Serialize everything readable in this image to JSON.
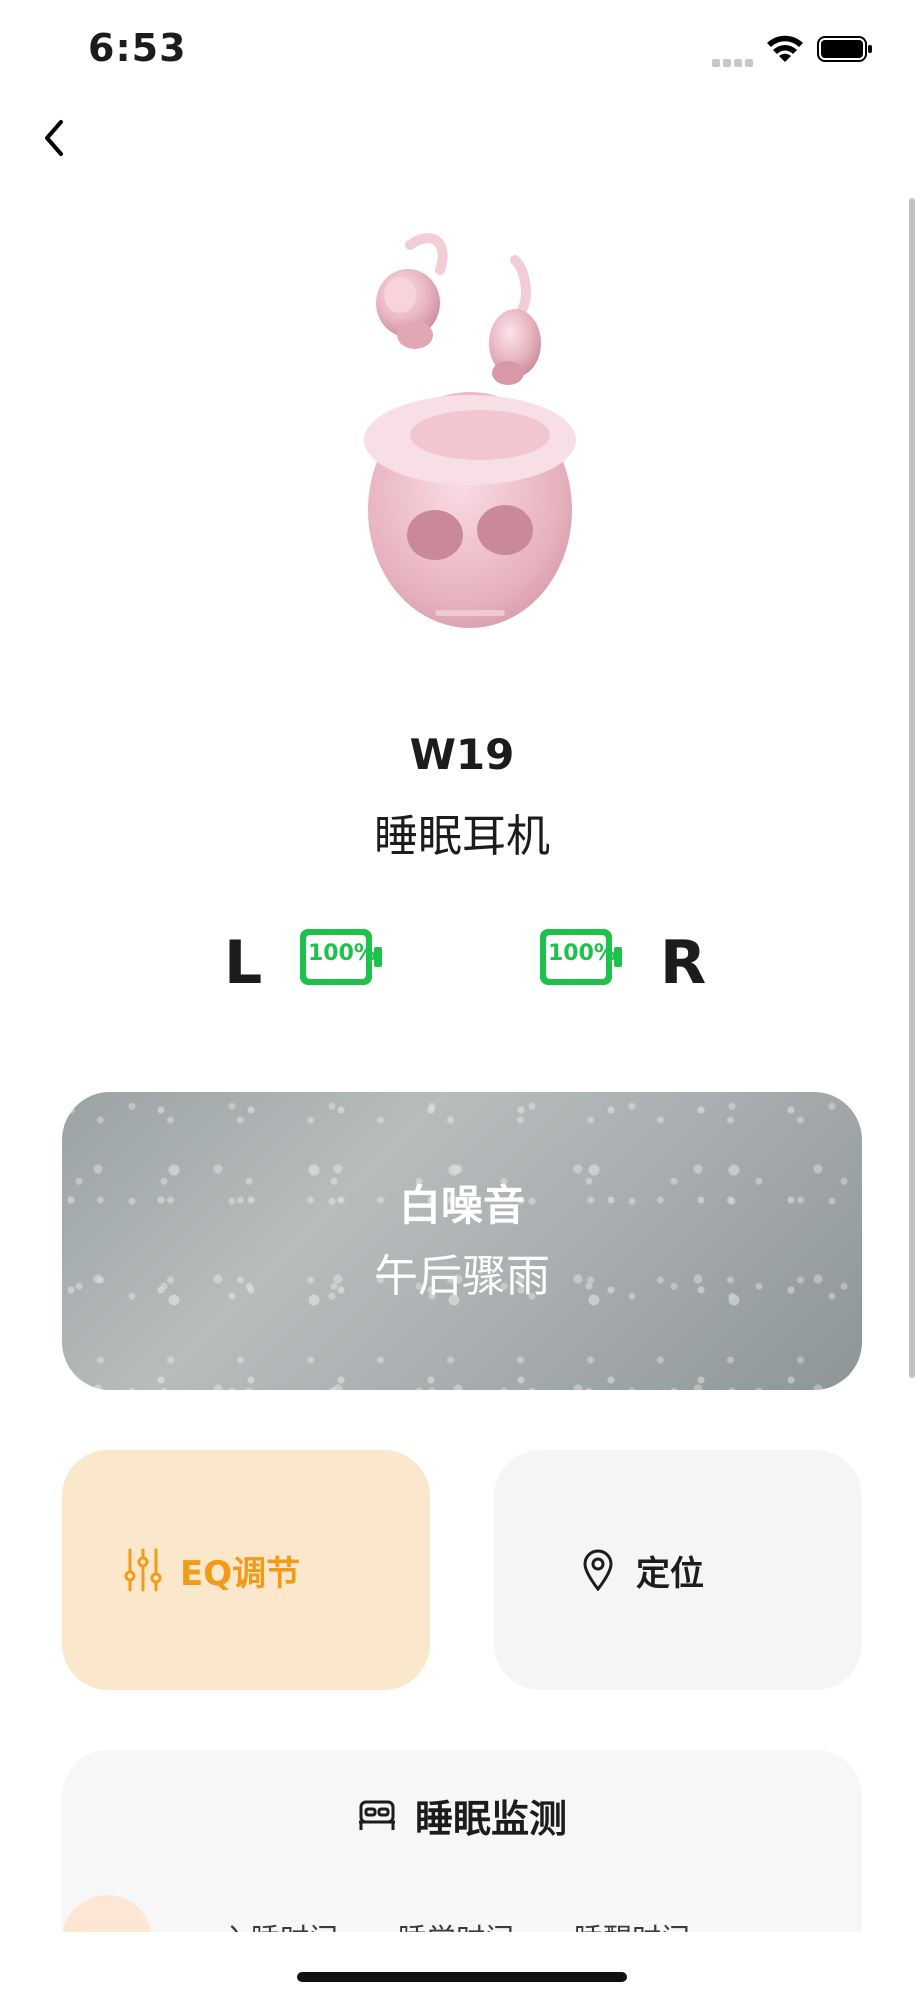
{
  "status_bar": {
    "time": "6:53"
  },
  "product": {
    "model": "W19",
    "name": "睡眠耳机"
  },
  "earbuds": {
    "left": {
      "label": "L",
      "battery_text": "100%",
      "battery_level": 1.0
    },
    "right": {
      "label": "R",
      "battery_text": "100%",
      "battery_level": 1.0
    }
  },
  "white_noise": {
    "title": "白噪音",
    "track": "午后骤雨"
  },
  "actions": {
    "eq_label": "EQ调节",
    "locate_label": "定位"
  },
  "sleep_monitor": {
    "title": "睡眠监测",
    "columns": [
      "入睡时间",
      "睡觉时间",
      "睡醒时间"
    ]
  },
  "colors": {
    "accent_orange": "#f29b19",
    "battery_green": "#1ec24a",
    "eq_tile_bg": "#fbe8cc"
  },
  "icons": [
    "back-chevron-icon",
    "wifi-icon",
    "battery-icon",
    "eq-sliders-icon",
    "location-pin-icon",
    "bed-icon"
  ]
}
